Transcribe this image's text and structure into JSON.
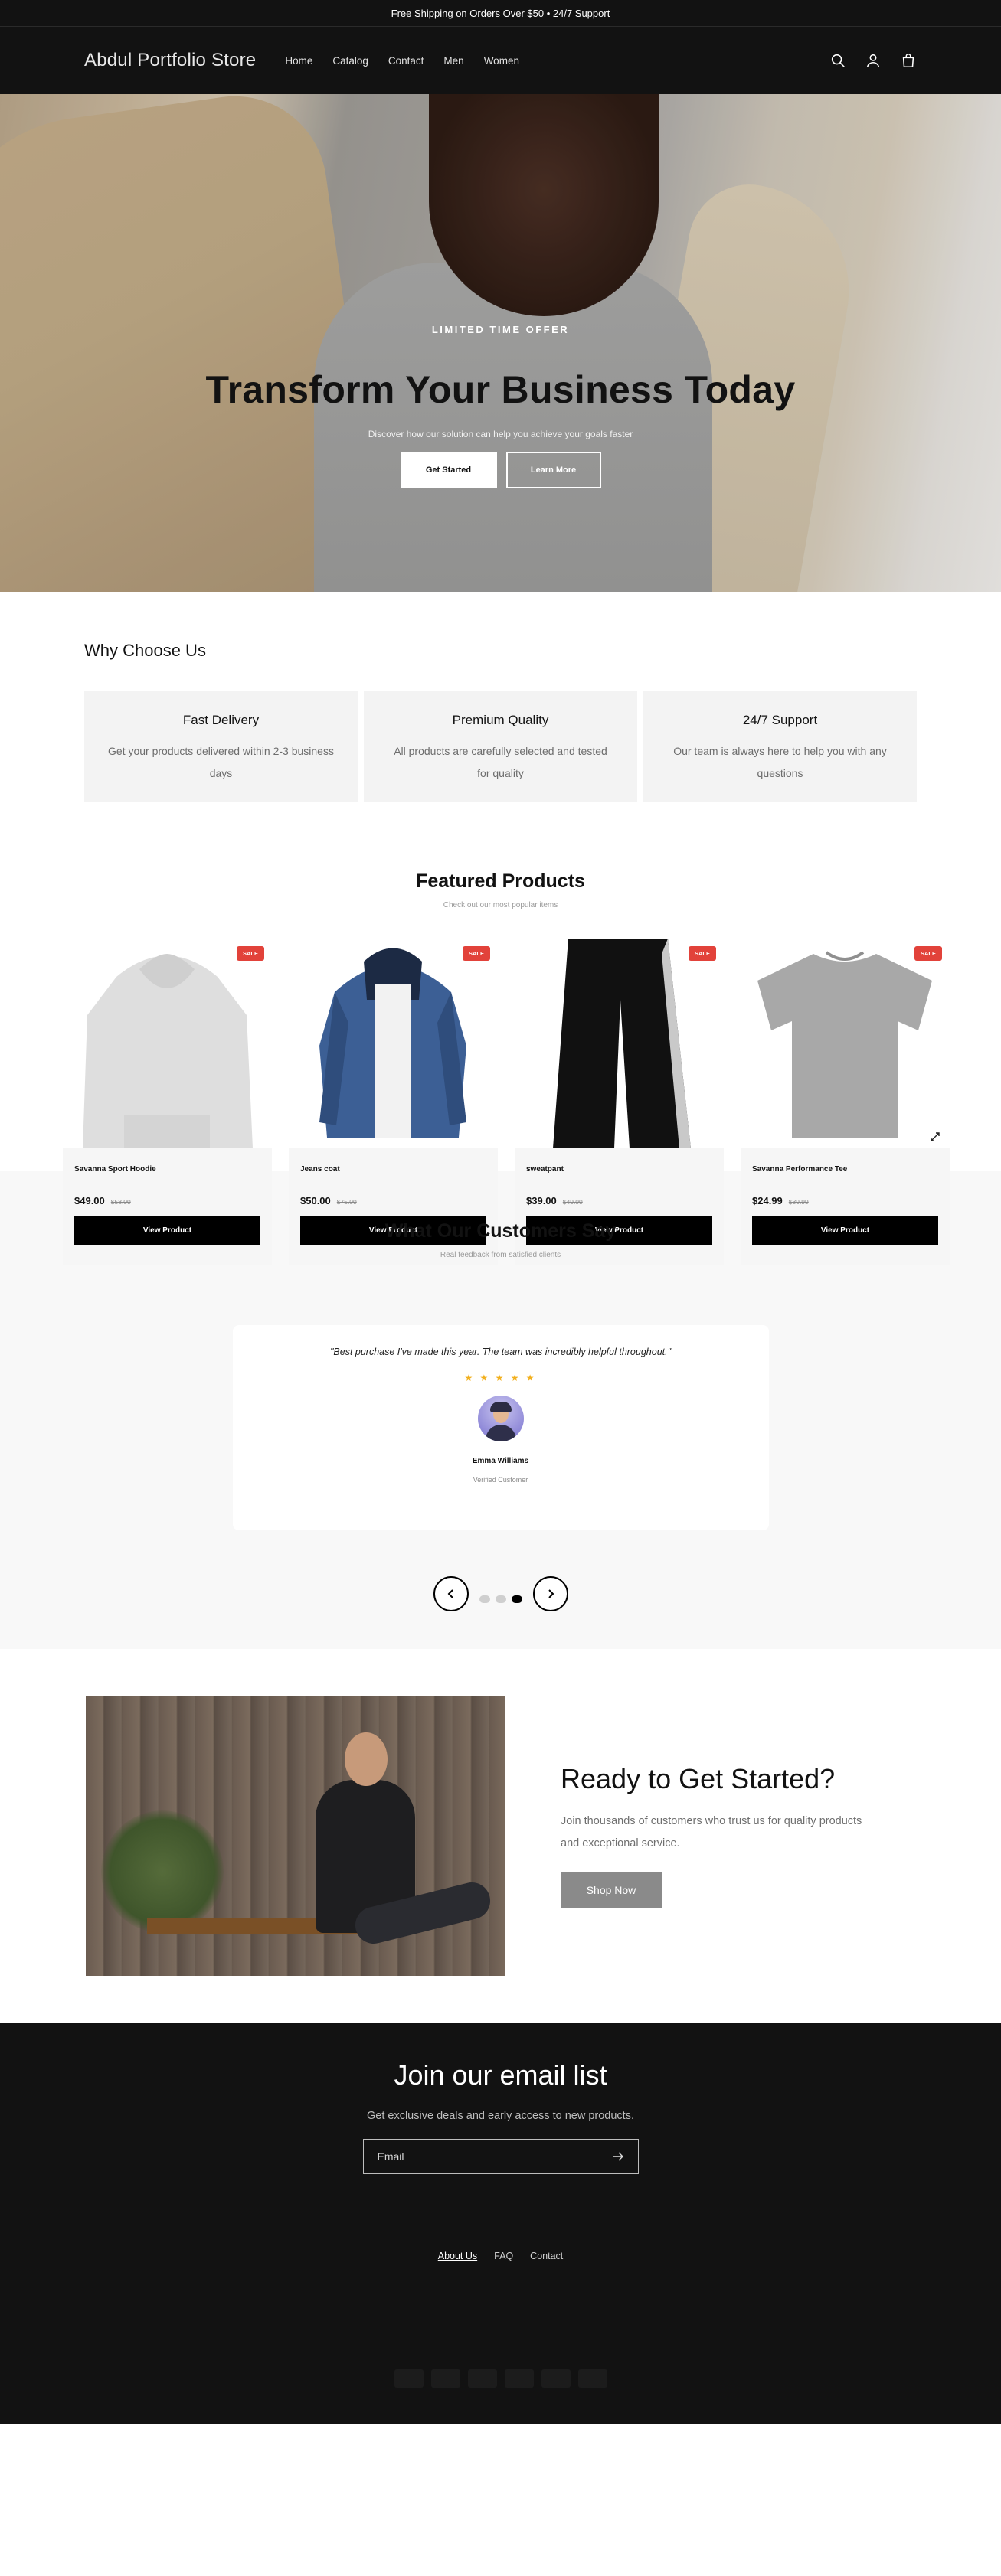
{
  "announcement": "Free Shipping on Orders Over $50 • 24/7 Support",
  "header": {
    "logo": "Abdul Portfolio Store",
    "nav": [
      "Home",
      "Catalog",
      "Contact",
      "Men",
      "Women"
    ],
    "icons": [
      "search-icon",
      "account-icon",
      "cart-icon"
    ]
  },
  "hero": {
    "kicker": "LIMITED TIME OFFER",
    "title": "Transform Your Business Today",
    "subtitle": "Discover how our solution can help you achieve your goals faster",
    "primary_button": "Get Started",
    "secondary_button": "Learn More"
  },
  "why": {
    "title": "Why Choose Us",
    "cards": [
      {
        "title": "Fast Delivery",
        "text": "Get your products delivered within 2-3 business days"
      },
      {
        "title": "Premium Quality",
        "text": "All products are carefully selected and tested for quality"
      },
      {
        "title": "24/7 Support",
        "text": "Our team is always here to help you with any questions"
      }
    ]
  },
  "featured": {
    "title": "Featured Products",
    "subtitle": "Check out our most popular items",
    "badge": "SALE",
    "button": "View Product",
    "products": [
      {
        "name": "Savanna Sport Hoodie",
        "price": "$49.00",
        "compare": "$58.00"
      },
      {
        "name": "Jeans coat",
        "price": "$50.00",
        "compare": "$75.00"
      },
      {
        "name": "sweatpant",
        "price": "$39.00",
        "compare": "$49.00"
      },
      {
        "name": "Savanna Performance Tee",
        "price": "$24.99",
        "compare": "$39.99"
      }
    ]
  },
  "testimonials": {
    "title": "What Our Customers Say",
    "subtitle": "Real feedback from satisfied clients",
    "quote": "\"Best purchase I've made this year. The team was incredibly helpful throughout.\"",
    "stars": "★ ★ ★ ★ ★",
    "name": "Emma Williams",
    "role": "Verified Customer",
    "slide_count": 3,
    "active_slide": 3
  },
  "cta": {
    "title": "Ready to Get Started?",
    "text": "Join thousands of customers who trust us for quality products and exceptional service.",
    "button": "Shop Now"
  },
  "footer": {
    "title": "Join our email list",
    "subtitle": "Get exclusive deals and early access to new products.",
    "email_placeholder": "Email",
    "links": [
      "About Us",
      "FAQ",
      "Contact"
    ]
  }
}
